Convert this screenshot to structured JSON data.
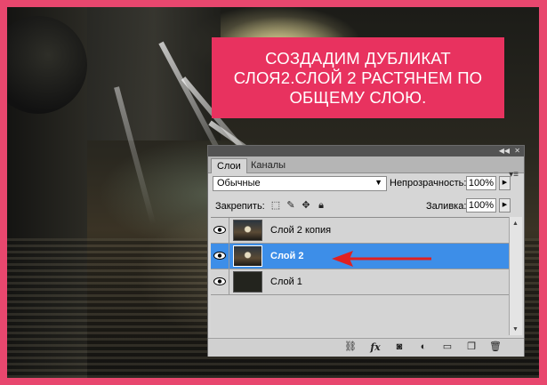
{
  "caption": {
    "text": "СОЗДАДИМ ДУБЛИКАТ\nСЛОЯ2.СЛОЙ 2 РАСТЯНЕМ ПО\nОБЩЕМУ СЛОЮ."
  },
  "panel": {
    "tabs": [
      {
        "label": "Слои",
        "active": true
      },
      {
        "label": "Каналы",
        "active": false
      }
    ],
    "blend_mode": "Обычные",
    "opacity_label": "Непрозрачность:",
    "opacity_value": "100%",
    "lock_label": "Закрепить:",
    "fill_label": "Заливка:",
    "fill_value": "100%",
    "layers": [
      {
        "name": "Слой 2 копия",
        "visible": true,
        "selected": false
      },
      {
        "name": "Слой 2",
        "visible": true,
        "selected": true
      },
      {
        "name": "Слой 1",
        "visible": true,
        "selected": false
      }
    ],
    "icons": {
      "lock": [
        "lock-transparent-pixels-icon",
        "lock-image-pixels-icon",
        "lock-position-icon",
        "lock-all-icon"
      ],
      "bottom": [
        "link-layers-icon",
        "fx-layer-style-icon",
        "add-mask-icon",
        "adjustment-layer-icon",
        "new-group-icon",
        "new-layer-icon",
        "delete-layer-icon"
      ]
    }
  },
  "colors": {
    "frame": "#e8476e",
    "caption_bg": "#e8325f",
    "selection": "#3d8ee8",
    "arrow": "#e02020"
  }
}
